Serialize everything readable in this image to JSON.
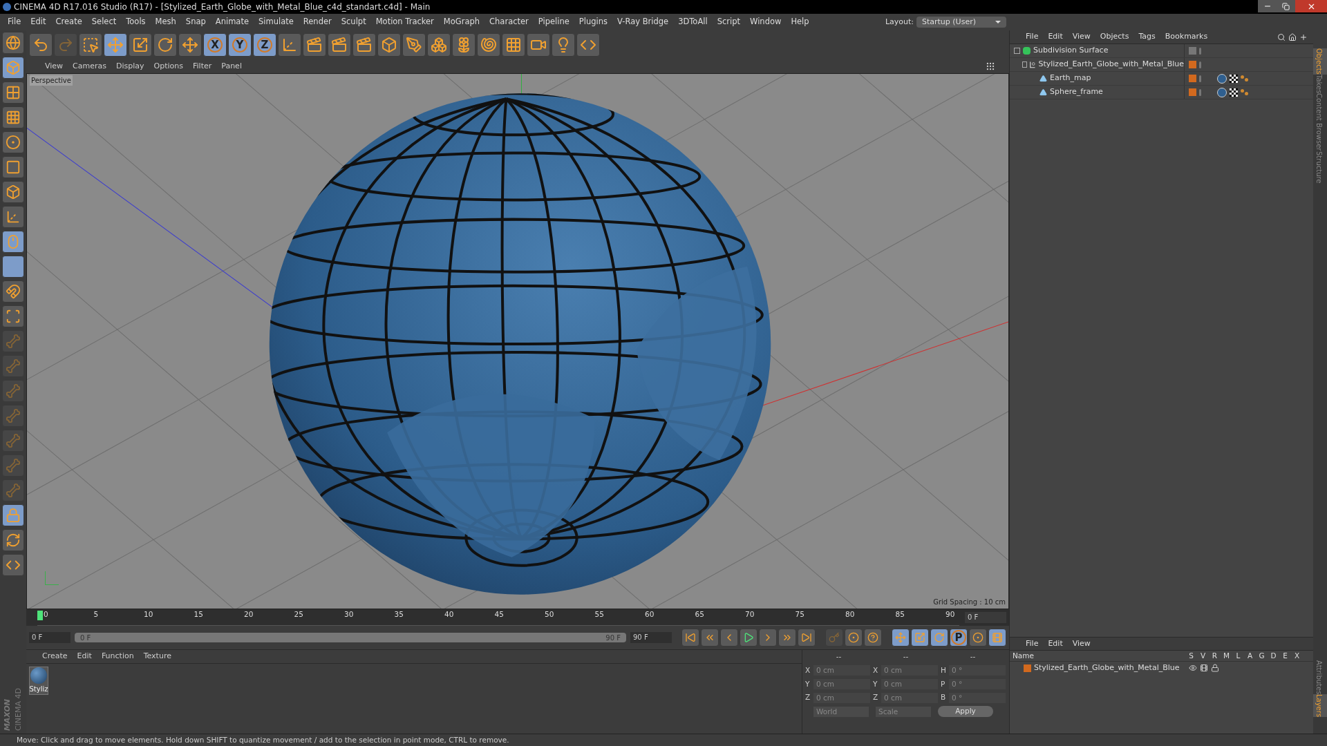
{
  "window": {
    "title": "CINEMA 4D R17.016 Studio (R17) - [Stylized_Earth_Globe_with_Metal_Blue_c4d_standart.c4d] - Main"
  },
  "menubar": [
    "File",
    "Edit",
    "Create",
    "Select",
    "Tools",
    "Mesh",
    "Snap",
    "Animate",
    "Simulate",
    "Render",
    "Sculpt",
    "Motion Tracker",
    "MoGraph",
    "Character",
    "Pipeline",
    "Plugins",
    "V-Ray Bridge",
    "3DToAll",
    "Script",
    "Window",
    "Help"
  ],
  "layout": {
    "label": "Layout:",
    "value": "Startup (User)"
  },
  "toolbar": [
    {
      "kind": "undo",
      "selected": false
    },
    {
      "kind": "redo",
      "selected": false,
      "disabled": true
    },
    {
      "kind": "select",
      "selected": false
    },
    {
      "kind": "move",
      "selected": true
    },
    {
      "kind": "scale",
      "selected": false
    },
    {
      "kind": "rotate",
      "selected": false
    },
    {
      "kind": "move",
      "selected": false
    },
    {
      "kind": "x-axis",
      "label": "X",
      "selected": true
    },
    {
      "kind": "y-axis",
      "label": "Y",
      "selected": true
    },
    {
      "kind": "z-axis",
      "label": "Z",
      "selected": true
    },
    {
      "kind": "coords",
      "selected": false
    },
    {
      "kind": "render",
      "selected": false
    },
    {
      "kind": "render",
      "selected": false
    },
    {
      "kind": "render",
      "selected": false
    },
    {
      "kind": "cube",
      "selected": false
    },
    {
      "kind": "pen",
      "selected": false
    },
    {
      "kind": "subdivide",
      "selected": false
    },
    {
      "kind": "cloner",
      "selected": false
    },
    {
      "kind": "deformer",
      "selected": false
    },
    {
      "kind": "floor",
      "selected": false
    },
    {
      "kind": "camera",
      "selected": false
    },
    {
      "kind": "light",
      "selected": false
    },
    {
      "kind": "python",
      "selected": false
    }
  ],
  "left_tools": [
    {
      "kind": "view",
      "selected": false,
      "disabled": false
    },
    {
      "kind": "model",
      "selected": true,
      "disabled": false
    },
    {
      "kind": "texture",
      "selected": false,
      "disabled": false
    },
    {
      "kind": "workplane",
      "selected": false,
      "disabled": false
    },
    {
      "kind": "points",
      "selected": false,
      "disabled": false
    },
    {
      "kind": "edges",
      "selected": false,
      "disabled": false
    },
    {
      "kind": "polygons",
      "selected": false,
      "disabled": false
    },
    {
      "kind": "axis",
      "selected": false,
      "disabled": false
    },
    {
      "kind": "tweak",
      "selected": true,
      "disabled": false
    },
    {
      "kind": "snap",
      "selected": true,
      "disabled": false
    },
    {
      "kind": "magnet",
      "selected": false,
      "disabled": false
    },
    {
      "kind": "workplane-axis",
      "selected": false,
      "disabled": false
    },
    {
      "kind": "joint",
      "selected": false,
      "disabled": true
    },
    {
      "kind": "joint",
      "selected": false,
      "disabled": true
    },
    {
      "kind": "joint",
      "selected": false,
      "disabled": true
    },
    {
      "kind": "joint",
      "selected": false,
      "disabled": true
    },
    {
      "kind": "joint",
      "selected": false,
      "disabled": true
    },
    {
      "kind": "joint",
      "selected": false,
      "disabled": true
    },
    {
      "kind": "joint",
      "selected": false,
      "disabled": true
    },
    {
      "kind": "lock-grid",
      "selected": true,
      "disabled": false
    },
    {
      "kind": "grid",
      "selected": false,
      "disabled": false
    },
    {
      "kind": "python",
      "selected": false,
      "disabled": false
    }
  ],
  "viewport": {
    "menu": [
      "View",
      "Cameras",
      "Display",
      "Options",
      "Filter",
      "Panel"
    ],
    "camera_label": "Perspective",
    "grid_spacing": "Grid Spacing : 10 cm"
  },
  "timeline": {
    "ticks": [
      "0",
      "5",
      "10",
      "15",
      "20",
      "25",
      "30",
      "35",
      "40",
      "45",
      "50",
      "55",
      "60",
      "65",
      "70",
      "75",
      "80",
      "85",
      "90"
    ],
    "current_frame": "0 F",
    "start_field": "0 F",
    "range_start": "0 F",
    "range_end": "90 F",
    "end_field": "90 F",
    "level": 0,
    "range": {
      "level": 1
    }
  },
  "transport": [
    {
      "kind": "first"
    },
    {
      "kind": "prev-key"
    },
    {
      "kind": "prev-frame"
    },
    {
      "kind": "play"
    },
    {
      "kind": "next-frame"
    },
    {
      "kind": "next-key"
    },
    {
      "kind": "last"
    }
  ],
  "record": [
    {
      "kind": "keys",
      "disabled": true
    },
    {
      "kind": "record"
    },
    {
      "kind": "help"
    }
  ],
  "key_modes": [
    {
      "kind": "move",
      "selected": true
    },
    {
      "kind": "scale",
      "selected": true
    },
    {
      "kind": "rotate",
      "selected": true
    },
    {
      "kind": "param",
      "label": "P",
      "selected": true
    },
    {
      "kind": "points",
      "selected": false
    },
    {
      "kind": "film",
      "selected": true
    }
  ],
  "materials": {
    "menu": [
      "Create",
      "Edit",
      "Function",
      "Texture"
    ],
    "items": [
      {
        "name": "Styliz"
      }
    ]
  },
  "brand": {
    "line_1": "MAXON",
    "line_2": "CINEMA 4D"
  },
  "coordinates": {
    "headers": [
      "--",
      "--",
      "--"
    ],
    "rows": [
      {
        "axis": "X",
        "position": "0 cm",
        "axis_2": "X",
        "size": "0 cm",
        "rot_label": "H",
        "rotation": "0 °"
      },
      {
        "axis": "Y",
        "position": "0 cm",
        "axis_2": "Y",
        "size": "0 cm",
        "rot_label": "P",
        "rotation": "0 °"
      },
      {
        "axis": "Z",
        "position": "0 cm",
        "axis_2": "Z",
        "size": "0 cm",
        "rot_label": "B",
        "rotation": "0 °"
      }
    ],
    "space": "World",
    "mode": "Scale",
    "apply": "Apply"
  },
  "object_manager": {
    "menu": [
      "File",
      "Edit",
      "View",
      "Objects",
      "Tags",
      "Bookmarks"
    ],
    "tree": [
      {
        "name": "Subdivision Surface",
        "kind": "subdivision",
        "expanded": true,
        "children": [
          {
            "name": "Stylized_Earth_Globe_with_Metal_Blue",
            "kind": "null",
            "expanded": true,
            "children": [
              {
                "name": "Earth_map",
                "kind": "polygon"
              },
              {
                "name": "Sphere_frame",
                "kind": "polygon"
              }
            ]
          }
        ]
      }
    ]
  },
  "layer_manager": {
    "menu": [
      "File",
      "Edit",
      "View"
    ],
    "columns": [
      "Name",
      "S",
      "V",
      "R",
      "M",
      "L",
      "A",
      "G",
      "D",
      "E",
      "X"
    ],
    "rows": [
      {
        "name": "Stylized_Earth_Globe_with_Metal_Blue",
        "color": "#d2691e"
      }
    ]
  },
  "side_tabs_top": [
    {
      "label": "Objects",
      "selected": true
    },
    {
      "label": "Takes",
      "selected": false
    },
    {
      "label": "Content Browser",
      "selected": false
    },
    {
      "label": "Structure",
      "selected": false
    }
  ],
  "side_tabs_bottom": [
    {
      "label": "Attributes",
      "selected": false
    },
    {
      "label": "Layers",
      "selected": true
    }
  ],
  "status_bar": "Move: Click and drag to move elements. Hold down SHIFT to quantize movement / add to the selection in point mode, CTRL to remove."
}
